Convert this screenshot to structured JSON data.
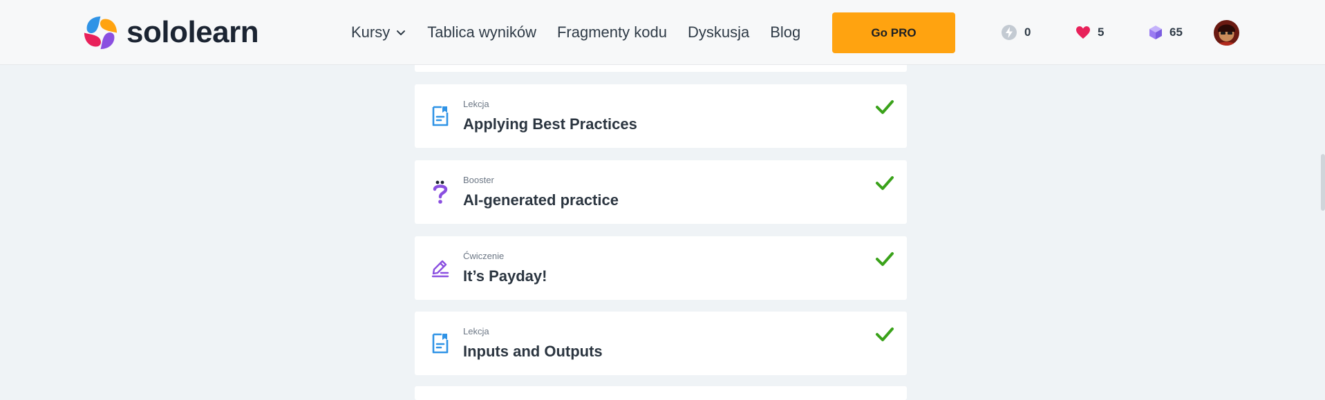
{
  "header": {
    "logo_text": "sololearn",
    "nav": [
      {
        "label": "Kursy",
        "has_dropdown": true
      },
      {
        "label": "Tablica wyników"
      },
      {
        "label": "Fragmenty kodu"
      },
      {
        "label": "Dyskusja"
      },
      {
        "label": "Blog"
      }
    ],
    "go_pro_label": "Go PRO",
    "stats": {
      "streak": "0",
      "hearts": "5",
      "gems": "65"
    }
  },
  "lessons": [
    {
      "type": "Lekcja",
      "title": "Applying Best Practices",
      "icon": "lesson-doc-icon",
      "completed": true
    },
    {
      "type": "Booster",
      "title": "AI-generated practice",
      "icon": "booster-question-icon",
      "completed": true
    },
    {
      "type": "Ćwiczenie",
      "title": "It’s Payday!",
      "icon": "exercise-pencil-icon",
      "completed": true
    },
    {
      "type": "Lekcja",
      "title": "Inputs and Outputs",
      "icon": "lesson-doc-icon",
      "completed": true
    }
  ],
  "colors": {
    "accent_orange": "#ffa310",
    "check_green": "#3aa21a",
    "lesson_blue": "#2f93e6",
    "booster_purple": "#7c4ed8",
    "heart_pink": "#e8215a",
    "gem_purple": "#9a7cf2"
  }
}
